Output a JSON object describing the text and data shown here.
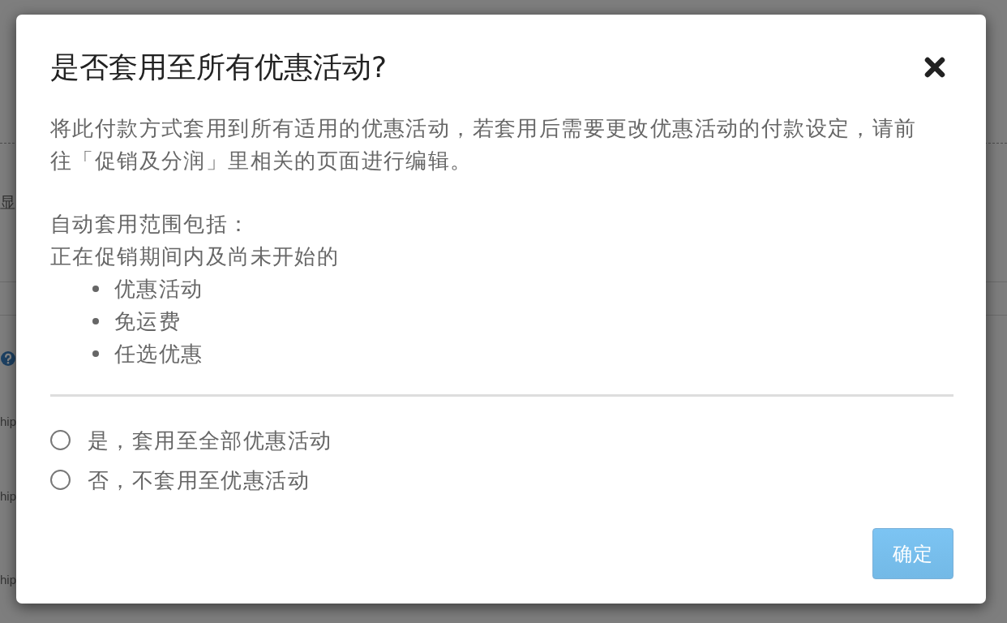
{
  "background_page": {
    "heading_fragment": "显",
    "row_fragments": [
      "hip",
      "hip",
      "hip"
    ]
  },
  "dialog": {
    "title": "是否套用至所有优惠活动?",
    "description": "将此付款方式套用到所有适用的优惠活动，若套用后需要更改优惠活动的付款设定，请前往「促销及分润」里相关的页面进行编辑。",
    "scope_label": "自动套用范围包括：",
    "scope_note": "正在促销期间内及尚未开始的",
    "scope_items": [
      "优惠活动",
      "免运费",
      "任选优惠"
    ],
    "options": [
      {
        "label": "是，套用至全部优惠活动",
        "selected": false
      },
      {
        "label": "否，不套用至优惠活动",
        "selected": false
      }
    ],
    "confirm_button": {
      "label": "确定",
      "disabled": true
    }
  }
}
